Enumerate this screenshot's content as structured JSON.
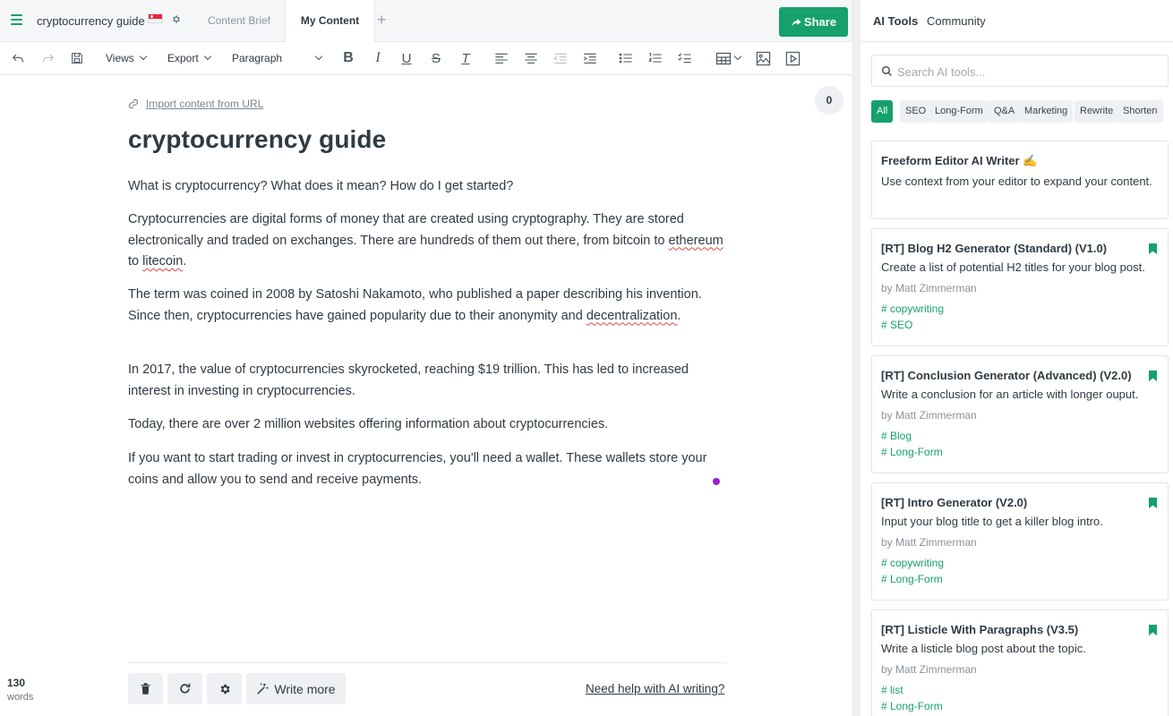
{
  "topbar": {
    "doc_title": "cryptocurrency guide",
    "tabs": [
      "Content Brief",
      "My Content"
    ],
    "add_tab": "+",
    "share_label": "Share"
  },
  "toolbar": {
    "views": "Views",
    "export": "Export",
    "format": "Paragraph",
    "bold": "B",
    "italic": "I",
    "underline": "U",
    "strike": "S",
    "clear": "T"
  },
  "editor": {
    "import_link": "Import content from URL",
    "heading": "cryptocurrency guide",
    "counter": "0",
    "p1": "What is cryptocurrency? What does it mean? How do I get started?",
    "p2_a": "Cryptocurrencies are digital forms of money that are created using cryptography. They are stored electronically and traded on exchanges. There are hundreds of them out there, from bitcoin to ",
    "p2_w1": "ethereum",
    "p2_b": " to ",
    "p2_w2": "litecoin",
    "p2_c": ".",
    "p3_a": "The term was coined in 2008 by Satoshi Nakamoto, who published a paper describing his invention. Since then, cryptocurrencies have gained popularity due to their anonymity and ",
    "p3_w1": "decentralization",
    "p3_b": ".",
    "p4": "In 2017, the value of cryptocurrencies skyrocketed, reaching $19 trillion. This has led to increased interest in investing in cryptocurrencies.",
    "p5": "Today, there are over 2 million websites offering information about cryptocurrencies.",
    "p6": "If you want to start trading or invest in cryptocurrencies, you'll need a wallet. These wallets store your coins and allow you to send and receive payments."
  },
  "footer": {
    "word_count": "130",
    "word_label": "words",
    "write_more": "Write more",
    "help": "Need help with AI writing?"
  },
  "ai": {
    "tabs": [
      "AI Tools",
      "Community"
    ],
    "search_placeholder": "Search AI tools...",
    "filters": [
      "All",
      "SEO",
      "Long-Form",
      "Q&A",
      "Marketing",
      "Rewrite",
      "Shorten"
    ],
    "cards": [
      {
        "title": "Freeform Editor AI Writer ✍️",
        "desc": "Use context from your editor to expand your content."
      },
      {
        "title": "[RT] Blog H2 Generator (Standard) (V1.0)",
        "desc": "Create a list of potential H2 titles for your blog post.",
        "author": "by Matt Zimmerman",
        "tags": [
          "# copywriting",
          "# SEO"
        ]
      },
      {
        "title": "[RT] Conclusion Generator (Advanced) (V2.0)",
        "desc": "Write a conclusion for an article with longer ouput.",
        "author": "by Matt Zimmerman",
        "tags": [
          "# Blog",
          "# Long-Form"
        ]
      },
      {
        "title": "[RT] Intro Generator (V2.0)",
        "desc": "Input your blog title to get a killer blog intro.",
        "author": "by Matt Zimmerman",
        "tags": [
          "# copywriting",
          "# Long-Form"
        ]
      },
      {
        "title": "[RT] Listicle With Paragraphs (V3.5)",
        "desc": "Write a listicle blog post about the topic.",
        "author": "by Matt Zimmerman",
        "tags": [
          "# list",
          "# Long-Form"
        ]
      }
    ]
  },
  "colors": {
    "accent": "#16a06c",
    "text": "#2f3a45",
    "spell_underline": "#e04646",
    "cursor_dot": "#9b1fd1"
  }
}
